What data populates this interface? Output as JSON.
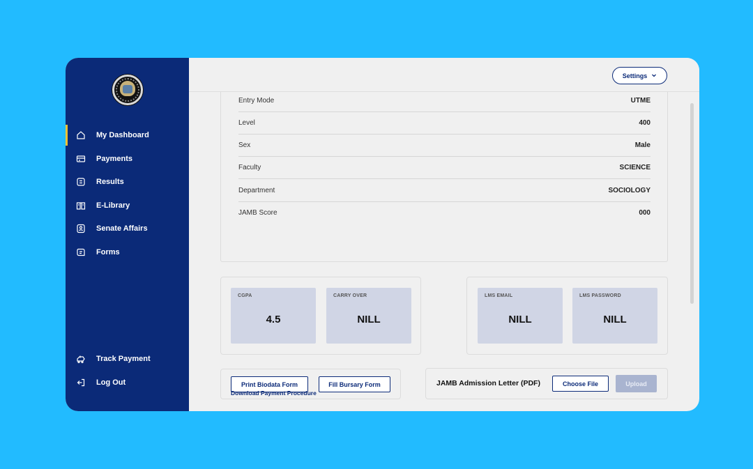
{
  "sidebar": {
    "items": [
      {
        "label": "My Dashboard",
        "icon": "home-icon",
        "active": true
      },
      {
        "label": "Payments",
        "icon": "card-icon"
      },
      {
        "label": "Results",
        "icon": "document-icon"
      },
      {
        "label": "E-Library",
        "icon": "book-icon"
      },
      {
        "label": "Senate Affairs",
        "icon": "user-badge-icon"
      },
      {
        "label": "Forms",
        "icon": "forms-icon"
      }
    ],
    "bottom": [
      {
        "label": "Track Payment",
        "icon": "track-icon"
      },
      {
        "label": "Log Out",
        "icon": "logout-icon"
      }
    ]
  },
  "header": {
    "settings_label": "Settings"
  },
  "profile": {
    "rows": [
      {
        "key": "Entry Mode",
        "value": "UTME"
      },
      {
        "key": "Level",
        "value": "400"
      },
      {
        "key": "Sex",
        "value": "Male"
      },
      {
        "key": "Faculty",
        "value": "SCIENCE"
      },
      {
        "key": "Department",
        "value": "SOCIOLOGY"
      },
      {
        "key": "JAMB Score",
        "value": "000"
      }
    ]
  },
  "stats": [
    {
      "title": "CGPA",
      "value": "4.5"
    },
    {
      "title": "CARRY OVER",
      "value": "NILL"
    },
    {
      "title": "LMS EMAIL",
      "value": "NILL"
    },
    {
      "title": "LMS PASSWORD",
      "value": "NILL"
    }
  ],
  "actions": {
    "print_biodata": "Print Biodata Form",
    "fill_bursary": "Fill Bursary Form",
    "jamb_label": "JAMB Admission Letter (PDF)",
    "choose_file": "Choose File",
    "upload": "Upload"
  },
  "download_link": "Download Payment Procedure",
  "colors": {
    "primary": "#0B2A78",
    "accent": "#F2C232",
    "background": "#22BBFF",
    "stat_bg": "#D0D5E5"
  }
}
